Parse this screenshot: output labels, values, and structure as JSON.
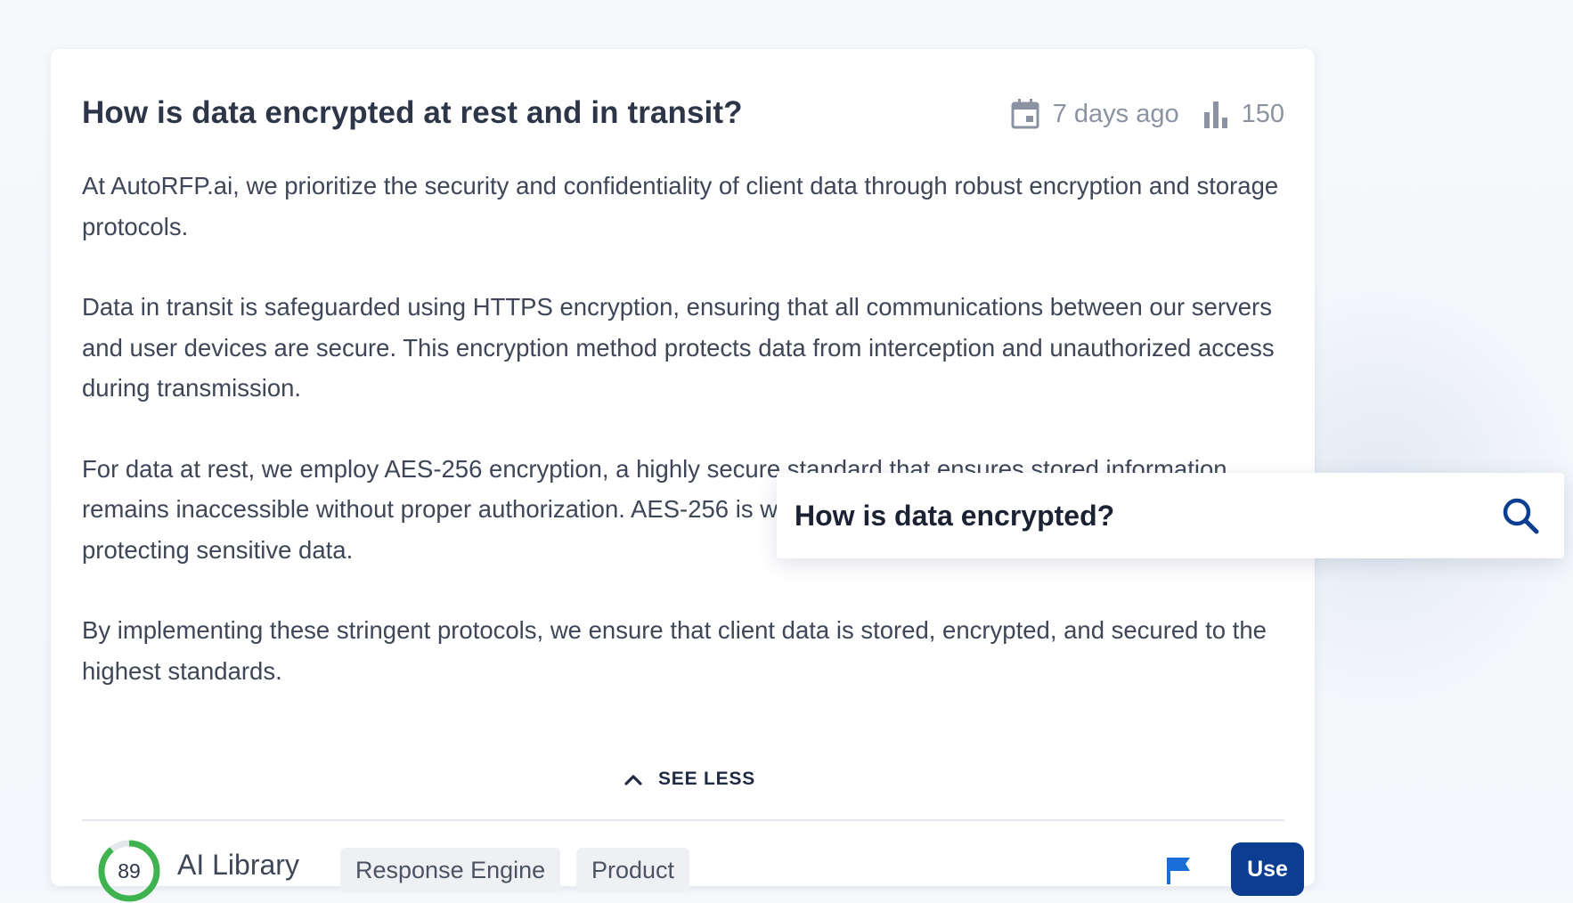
{
  "question": {
    "title": "How is data encrypted at rest and in transit?",
    "date_label": "7 days ago",
    "usage_count": "150"
  },
  "answer": {
    "paragraphs": [
      "At AutoRFP.ai, we prioritize the security and confidentiality of client data through robust encryption and storage protocols.",
      "Data in transit is safeguarded using HTTPS encryption, ensuring that all communications between our servers and user devices are secure. This encryption method protects data from interception and unauthorized access during transmission.",
      "For data at rest, we employ AES-256 encryption, a highly secure standard that ensures stored information remains inaccessible without proper authorization. AES-256 is widely recognized for its effectiveness in protecting sensitive data.",
      "By implementing these stringent protocols, we ensure that client data is stored, encrypted, and secured to the highest standards."
    ]
  },
  "controls": {
    "see_less_label": "SEE LESS"
  },
  "footer": {
    "score": "89",
    "score_fraction": 0.89,
    "source_label": "AI Library",
    "tags": [
      "Response Engine",
      "Product"
    ],
    "use_label": "Use"
  },
  "search": {
    "value": "How is data encrypted?"
  },
  "colors": {
    "score_ring": "#3fb34f",
    "score_track": "#e3e6ea",
    "flag": "#1a6fd6",
    "primary_button": "#0b3d91"
  },
  "icons": {
    "date": "calendar-icon",
    "usage": "bar-chart-icon",
    "collapse": "chevron-up-icon",
    "flag": "flag-icon",
    "search": "search-icon"
  }
}
